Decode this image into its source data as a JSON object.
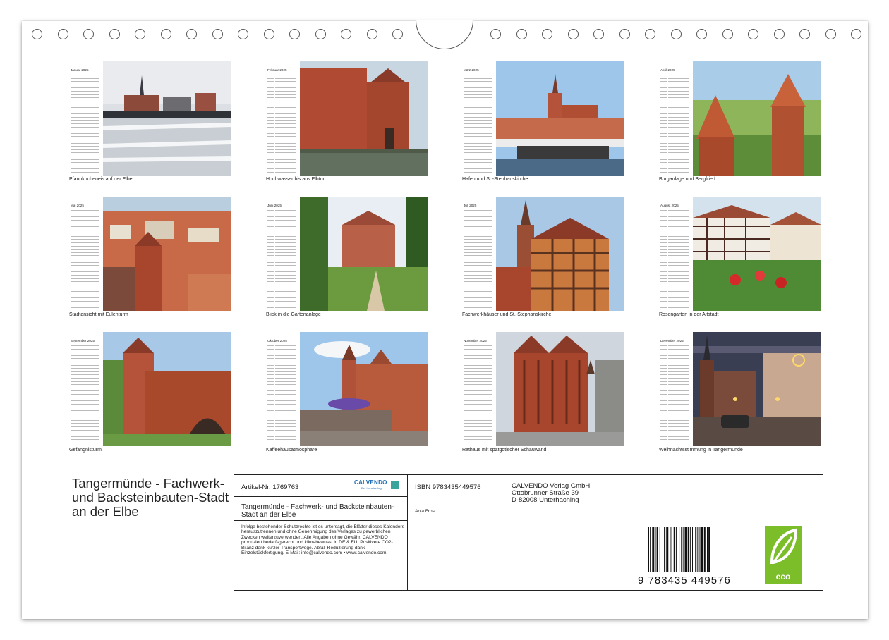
{
  "months": [
    {
      "key": "jan",
      "title": "Januar 2025",
      "caption": "Pfannkucheneis auf der Elbe"
    },
    {
      "key": "feb",
      "title": "Februar 2025",
      "caption": "Hochwasser bis ans Elbtor"
    },
    {
      "key": "mar",
      "title": "März 2025",
      "caption": "Hafen und St.-Stephanskirche"
    },
    {
      "key": "apr",
      "title": "April 2025",
      "caption": "Burganlage und Bergfried"
    },
    {
      "key": "may",
      "title": "Mai 2025",
      "caption": "Stadtansicht mit Eulenturm"
    },
    {
      "key": "jun",
      "title": "Juni 2025",
      "caption": "Blick in die Gartenanlage"
    },
    {
      "key": "jul",
      "title": "Juli 2025",
      "caption": "Fachwerkhäuser und St.-Stephanskirche"
    },
    {
      "key": "aug",
      "title": "August 2025",
      "caption": "Rosengarten in der Altstadt"
    },
    {
      "key": "sep",
      "title": "September 2025",
      "caption": "Gefängnisturm"
    },
    {
      "key": "oct",
      "title": "Oktober 2025",
      "caption": "Kaffeehausatmosphäre"
    },
    {
      "key": "nov",
      "title": "November 2025",
      "caption": "Rathaus mit spätgotischer Schauwand"
    },
    {
      "key": "dec",
      "title": "Dezember 2025",
      "caption": "Weihnachtsstimmung in Tangermünde"
    }
  ],
  "cover_title": "Tangermünde - Fachwerk- und Backsteinbauten-Stadt an der Elbe",
  "info": {
    "article": "Artikel-Nr. 1769763",
    "logo": "CALVENDO",
    "logo_sub": "Der Kunstverlag",
    "product_title": "Tangermünde - Fachwerk- und Backsteinbauten-Stadt an der Elbe",
    "legal_text": "Infolge bestehender Schutzrechte ist es untersagt, die Blätter dieses Kalenders herauszutrennen und ohne Genehmigung des Verlages zu gewerblichen Zwecken weiterzuverwenden. Alle Angaben ohne Gewähr. CALVENDO produziert bedarfsgerecht und klimabewusst in DE & EU. Positivere CO2-Bilanz dank kurzer Transportwege. Abfall-Reduzierung dank Einzelstückfertigung. E-Mail: info@calvendo.com • www.calvendo.com",
    "isbn": "ISBN 9783435449576",
    "author": "Anja Frost",
    "publisher_line1": "CALVENDO Verlag GmbH",
    "publisher_line2": "Ottobrunner Straße 39",
    "publisher_line3": "D-82008 Unterhaching",
    "barcode_number": "9 783435 449576",
    "eco_label": "eco"
  },
  "colors": {
    "brick": "#a8492c",
    "sky": "#9fc4e8",
    "green": "#5b8a3a",
    "eco_green": "#7cbd2a",
    "calvendo_blue": "#1e6cb3"
  }
}
